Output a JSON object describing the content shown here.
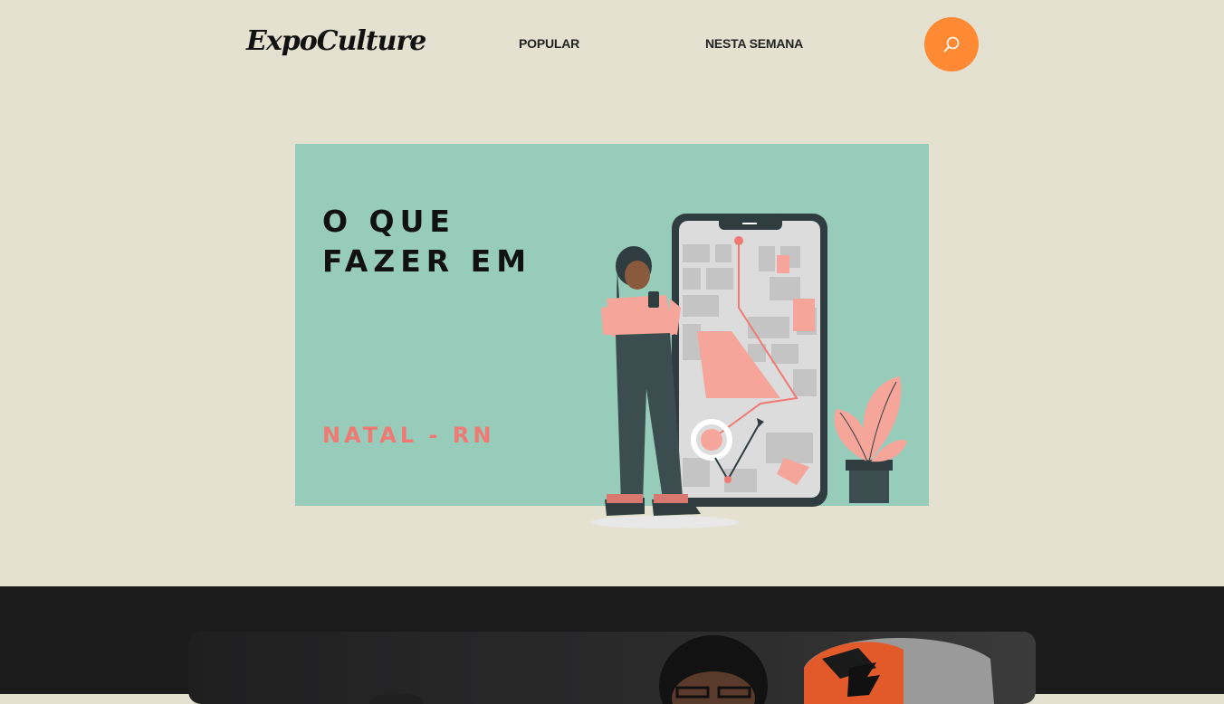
{
  "header": {
    "logo": "ExpoCulture",
    "nav": [
      {
        "label": "POPULAR"
      },
      {
        "label": "NESTA SEMANA"
      }
    ],
    "search_icon": "search-icon",
    "accent_color": "#ff8a33"
  },
  "hero": {
    "title_line1": "O QUE",
    "title_line2": "FAZER EM",
    "city": "NATAL - RN",
    "background_color": "#98ccba",
    "city_color": "#f07a73",
    "illustration": "woman-with-phone-map-illustration"
  },
  "featured": {
    "image": "people-photo-thumbnail"
  }
}
